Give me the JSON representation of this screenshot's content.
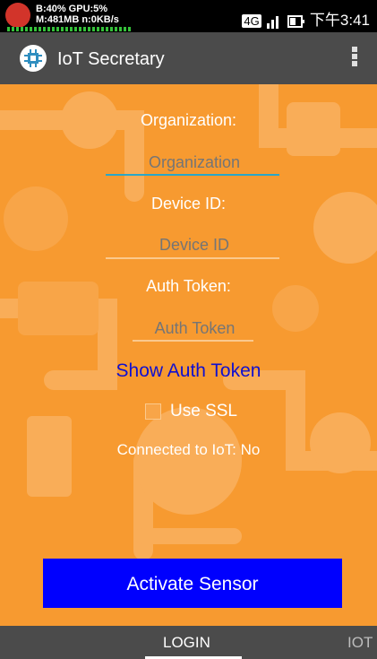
{
  "status_bar": {
    "overlay_line1": "B:40% GPU:5%",
    "overlay_line2": "M:481MB n:0KB/s",
    "network": "4G",
    "time": "下午3:41"
  },
  "app_bar": {
    "title": "IoT Secretary",
    "logo_icon": "chip-icon",
    "menu_icon": "overflow-menu-icon"
  },
  "form": {
    "organization_label": "Organization:",
    "organization_placeholder": "Organization",
    "organization_value": "",
    "device_id_label": "Device ID:",
    "device_id_placeholder": "Device ID",
    "device_id_value": "",
    "auth_token_label": "Auth Token:",
    "auth_token_placeholder": "Auth Token",
    "auth_token_value": "",
    "show_token_label": "Show Auth Token",
    "use_ssl_label": "Use SSL",
    "use_ssl_checked": false,
    "connection_status": "Connected to IoT: No",
    "activate_label": "Activate Sensor"
  },
  "tabs": [
    {
      "label": "LOGIN",
      "active": true
    },
    {
      "label": "IOT",
      "active": false
    }
  ],
  "colors": {
    "background": "#f79a30",
    "app_bar": "#4b4b4b",
    "button": "#0000fe",
    "link": "#1010d0",
    "focus_underline": "#2aa6c8"
  }
}
